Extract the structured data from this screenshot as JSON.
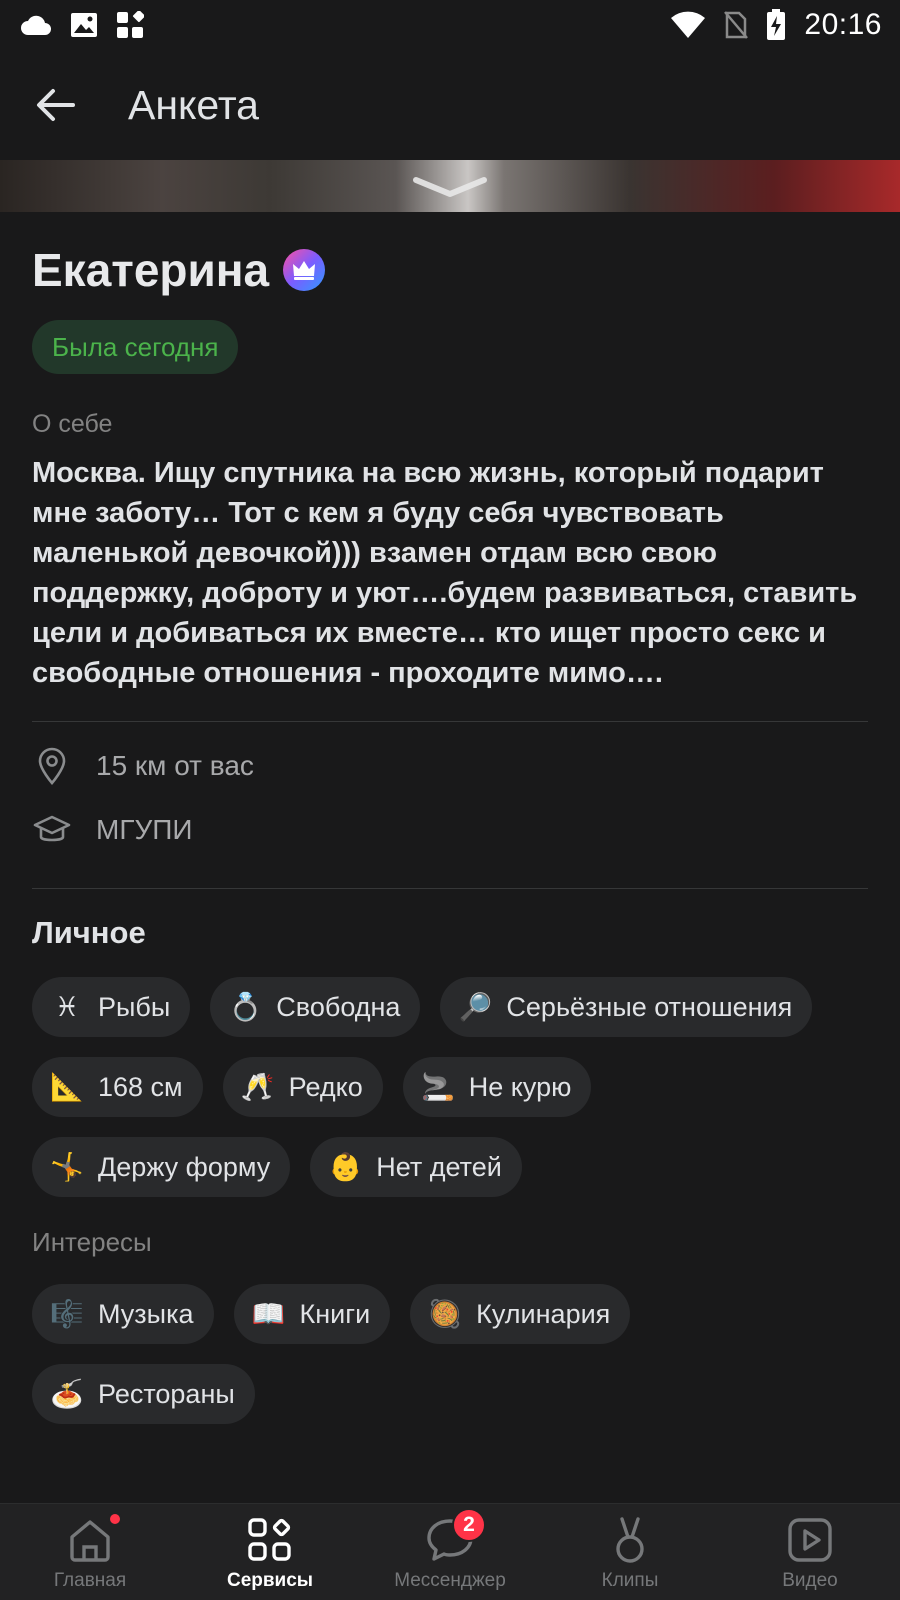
{
  "status_bar": {
    "time": "20:16",
    "left_icons": [
      "cloud-icon",
      "image-icon",
      "apps-icon"
    ],
    "right_icons": [
      "wifi-icon",
      "no-sim-icon",
      "battery-charging-icon"
    ]
  },
  "app_bar": {
    "title": "Анкета"
  },
  "profile": {
    "name": "Екатерина",
    "status": "Была сегодня",
    "about_label": "О себе",
    "about_text": "Москва. Ищу спутника на всю жизнь, который подарит мне заботу… Тот с кем я буду себя чувствовать маленькой девочкой))) взамен отдам всю свою поддержку, доброту и уют….будем развиваться, ставить цели и добиваться их вместе… кто ищет просто секс и свободные отношения - проходите мимо….",
    "distance": "15 км от вас",
    "education": "МГУПИ"
  },
  "personal": {
    "heading": "Личное",
    "chips": [
      {
        "emoji": "♓",
        "label": "Рыбы"
      },
      {
        "emoji": "💍",
        "label": "Свободна"
      },
      {
        "emoji": "🔎",
        "label": "Серьёзные отношения"
      },
      {
        "emoji": "📐",
        "label": "168 см"
      },
      {
        "emoji": "🥂",
        "label": "Редко"
      },
      {
        "emoji": "🚬",
        "label": "Не курю"
      },
      {
        "emoji": "🤸",
        "label": "Держу форму"
      },
      {
        "emoji": "👶",
        "label": "Нет детей"
      }
    ]
  },
  "interests": {
    "label": "Интересы",
    "chips": [
      {
        "emoji": "🎼",
        "label": "Музыка"
      },
      {
        "emoji": "📖",
        "label": "Книги"
      },
      {
        "emoji": "🥘",
        "label": "Кулинария"
      },
      {
        "emoji": "🍝",
        "label": "Рестораны"
      }
    ]
  },
  "tab_bar": {
    "tabs": [
      {
        "label": "Главная",
        "icon": "home-icon"
      },
      {
        "label": "Сервисы",
        "icon": "services-icon"
      },
      {
        "label": "Мессенджер",
        "icon": "chat-icon",
        "badge": "2"
      },
      {
        "label": "Клипы",
        "icon": "clips-icon"
      },
      {
        "label": "Видео",
        "icon": "video-icon"
      }
    ],
    "active_index": 1
  },
  "colors": {
    "background": "#19191a",
    "status_green": "#4bb34b",
    "badge_red": "#ff3347"
  }
}
